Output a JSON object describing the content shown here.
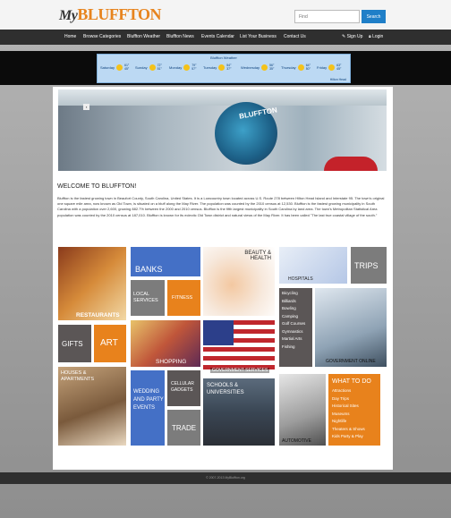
{
  "header": {
    "logo_my": "My",
    "logo_main": "BLUFFTON",
    "search_placeholder": "Find",
    "search_button": "Search"
  },
  "nav": {
    "items": [
      "Home",
      "Browse Categories",
      "Bluffton Weather",
      "Bluffton News",
      "Events Calendar",
      "List Your Business",
      "Contact Us"
    ],
    "signup": "Sign Up",
    "login": "Login"
  },
  "weather": {
    "title": "Bluffton Weather",
    "days": [
      {
        "name": "Saturday",
        "hi": "61°",
        "lo": "45°"
      },
      {
        "name": "Sunday",
        "hi": "72°",
        "lo": "51°"
      },
      {
        "name": "Monday",
        "hi": "79°",
        "lo": "57°"
      },
      {
        "name": "Tuesday",
        "hi": "54°",
        "lo": "37°"
      },
      {
        "name": "Wednesday",
        "hi": "56°",
        "lo": "35°"
      },
      {
        "name": "Thursday",
        "hi": "64°",
        "lo": "50°"
      },
      {
        "name": "Friday",
        "hi": "63°",
        "lo": "45°"
      }
    ],
    "footer": "Hilton Head"
  },
  "welcome": {
    "title": "WELCOME TO BLUFFTON!",
    "text": "Bluffton is the fastest growing town in Beaufort County, South Carolina, United States. It is a Lowcountry town located across U.S. Route 278 between Hilton Head Island and Interstate 95. The town's original one square mile area, now known as Old Town, is situated on a bluff along the May River. The population was counted by the 2010 census at 12,530. Bluffton is the fastest growing municipality in South Carolina with a population over 2,600, growing 882.7% between the 2000 and 2010 census. Bluffton is the fifth largest municipality in South Carolina by land area. The town's Metropolitan Statistical Area population was counted by the 2010 census at 187,010. Bluffton is known for its eclectic Old Town district and natural views of the May River. It has been called \"The last true coastal village of the south.\""
  },
  "tiles": {
    "restaurants": "RESTAURANTS",
    "banks": "BANKS",
    "local_services": "LOCAL SERVICES",
    "fitness": "FITNESS",
    "beauty": "BEAUTY & HEALTH",
    "hospitals": "HOSPITALS",
    "trips": "TRIPS",
    "recreation": [
      "Bicycling",
      "Billiards",
      "Bowling",
      "Camping",
      "Golf Courses",
      "Gymnastics",
      "Martial Arts",
      "Fishing"
    ],
    "gifts": "GIFTS",
    "art": "ART",
    "shopping": "SHOPPING",
    "government_services": "GOVERNMENT SERVICES",
    "government_online": "GOVERNMENT ONLINE",
    "houses": "HOUSES & APARTMENTS",
    "wedding": "WEDDING AND PARTY EVENTS",
    "cellular": "CELLULAR GADGETS",
    "trade": "TRADE",
    "schools": "SCHOOLS & UNIVERSITIES",
    "automotive": "AUTOMOTIVE",
    "what_to_do_title": "WHAT TO DO",
    "what_to_do": [
      "Attractions",
      "Day Trips",
      "Historical Sites",
      "Museums",
      "Nightlife",
      "Theaters & Shows",
      "Kids Party & Play"
    ]
  },
  "footer": {
    "copyright": "© 2007-2013 MyBluffton.org"
  }
}
